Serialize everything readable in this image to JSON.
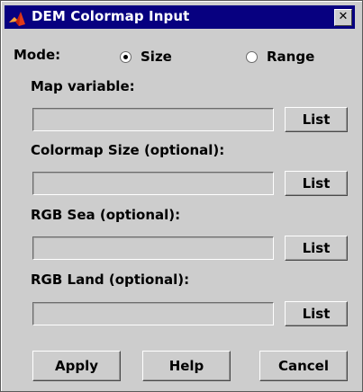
{
  "window": {
    "title": "DEM Colormap Input",
    "close_glyph": "✕",
    "accent_color": "#070080"
  },
  "mode": {
    "label": "Mode:",
    "options": [
      {
        "label": "Size",
        "selected": true
      },
      {
        "label": "Range",
        "selected": false
      }
    ]
  },
  "fields": [
    {
      "label": "Map variable:",
      "value": "",
      "button": "List"
    },
    {
      "label": "Colormap Size (optional):",
      "value": "",
      "button": "List"
    },
    {
      "label": "RGB Sea (optional):",
      "value": "",
      "button": "List"
    },
    {
      "label": "RGB Land (optional):",
      "value": "",
      "button": "List"
    }
  ],
  "buttons": {
    "apply": "Apply",
    "help": "Help",
    "cancel": "Cancel"
  }
}
